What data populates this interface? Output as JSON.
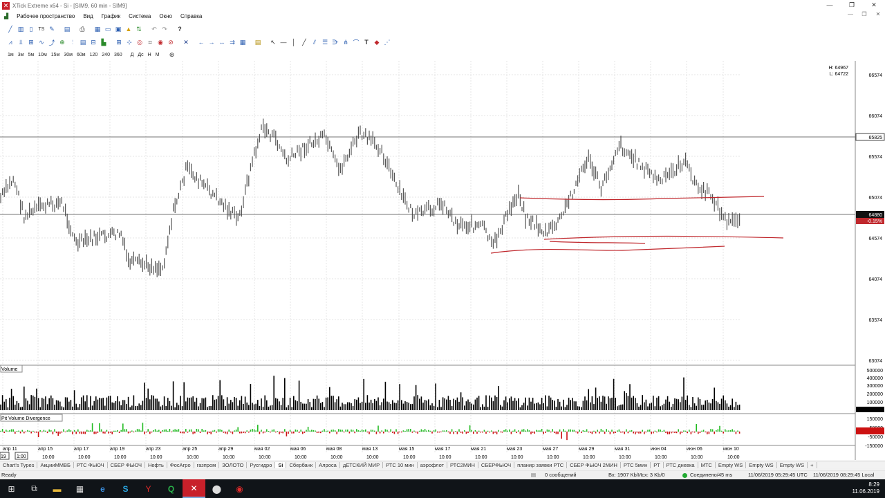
{
  "window": {
    "title": "XTick Extreme x64 - Si - [SIM9, 60 min - SIM9]",
    "minimize": "—",
    "restore": "❐",
    "close": "✕"
  },
  "menu": [
    "Рабочее пространство",
    "Вид",
    "График",
    "Система",
    "Окно",
    "Справка"
  ],
  "timeframes": [
    "1м",
    "3м",
    "5м",
    "10м",
    "15м",
    "30м",
    "60м",
    "120",
    "240",
    "360",
    "Д",
    "Дс",
    "Н",
    "М"
  ],
  "chart": {
    "hl_high": "H: 64967",
    "hl_low": "L: 64722",
    "price_labels": [
      "66574",
      "66074",
      "65574",
      "65074",
      "64574",
      "64074",
      "63574",
      "63074"
    ],
    "ref_price_label": "65825",
    "current_price_label": "64880",
    "change_label": "-0.15%",
    "volume_title": "Volume",
    "volume_labels": [
      "500000",
      "400000",
      "300000",
      "200000",
      "100000"
    ],
    "pvd_title": "Pit Volume Divergence",
    "pvd_labels": [
      "150000",
      "50000",
      "-50000",
      "-150000"
    ],
    "date_labels": [
      "апр 11",
      "апр 15",
      "апр 17",
      "апр 19",
      "апр 23",
      "апр 25",
      "апр 29",
      "мая 02",
      "мая 06",
      "мая 08",
      "мая 13",
      "мая 15",
      "мая 17",
      "мая 21",
      "мая 23",
      "мая 27",
      "мая 29",
      "мая 31",
      "июн 04",
      "июн 06",
      "июн 10"
    ],
    "time_label": "10:00",
    "cursor_left": "19",
    "cursor_time": "1:00"
  },
  "sheet_tabs": [
    "Chart's Types",
    "АкцииММВБ",
    "РТС ФЬЮЧ",
    "СБЕР ФЬЮЧ",
    "Нефть",
    "ФосАгро",
    "газпром",
    "ЗОЛОТО",
    "Русгидро",
    "Si",
    "Сбербанк",
    "Алроса",
    "дЕТСКИЙ МИР",
    "РТС 10 мин",
    "аэрофлот",
    "РТС2МИН",
    "СБЕРФЬЮЧ",
    "планир заявки РТС",
    "СБЕР ФЬЮЧ 2МИН",
    "РТС 5мин",
    "РТ",
    "РТС дневка",
    "МТС",
    "Empty WS",
    "Empty WS",
    "Empty WS"
  ],
  "active_tab": "Si",
  "status": {
    "ready": "Ready",
    "messages": "0 сообщений",
    "traffic": "Вх: 1907 Kb/Исх: 3 Kb/0",
    "connection": "Соединено/45 ms",
    "utc_time": "11/06/2019 05:29:45 UTC",
    "local_time": "11/06/2019 08:29:45 Local"
  },
  "clock": {
    "time": "8:29",
    "date": "11.06.2019"
  },
  "colors": {
    "grid": "#e4e4e4",
    "bar": "#555555",
    "trend": "#c0282d",
    "price_box": "#c0282d",
    "vol_bar": "#000000",
    "pvd_pos": "#22bb22",
    "pvd_neg": "#cc1111"
  }
}
